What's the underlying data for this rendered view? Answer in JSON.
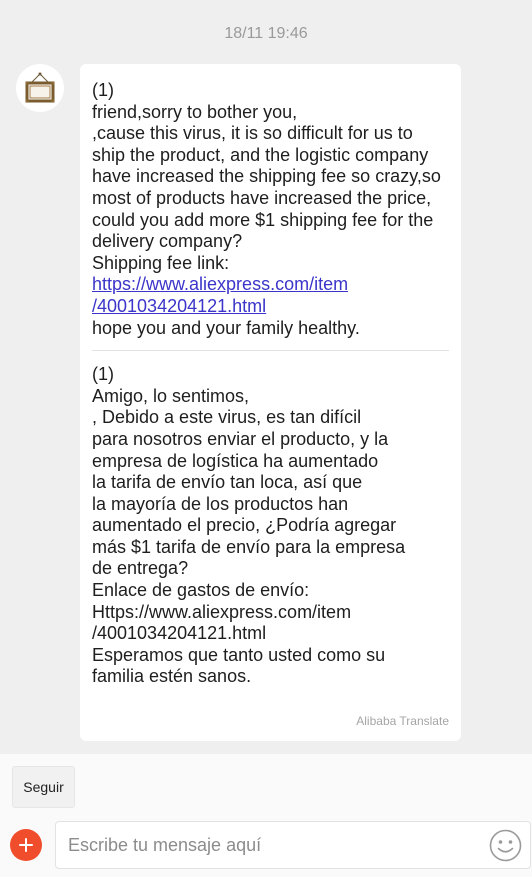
{
  "timestamp": "18/11 19:46",
  "message": {
    "original": {
      "text": "(1)\nfriend,sorry to bother you,\n,cause this virus, it is so difficult for us to\nship the product, and the logistic company\nhave increased the shipping fee so crazy,so\nmost of products have increased the price,\ncould you add more $1 shipping fee for the\ndelivery company?\nShipping fee link:",
      "link_text": "https://www.aliexpress.com/item\n/4001034204121.html",
      "closing": "hope you and your family healthy."
    },
    "translation": {
      "text": "(1)\nAmigo, lo sentimos,\n, Debido a este virus, es tan difícil\npara nosotros enviar el producto, y la\nempresa de logística ha aumentado\nla tarifa de envío tan loca, así que\nla mayoría de los productos han\naumentado el precio, ¿Podría agregar\nmás $1 tarifa de envío para la empresa\nde entrega?\nEnlace de gastos de envío:\nHttps://www.aliexpress.com/item\n/4001034204121.html\nEsperamos que tanto usted como su\nfamilia estén sanos."
    },
    "translation_credit": "Alibaba Translate"
  },
  "actions": {
    "follow_label": "Seguir"
  },
  "composer": {
    "placeholder": "Escribe tu mensaje aquí"
  },
  "icons": {
    "add": "plus-icon",
    "emoji": "smiley-icon",
    "avatar": "picture-frame-icon"
  },
  "colors": {
    "link": "#3b35c9",
    "add_button": "#f04d2c",
    "background": "#efefef"
  }
}
